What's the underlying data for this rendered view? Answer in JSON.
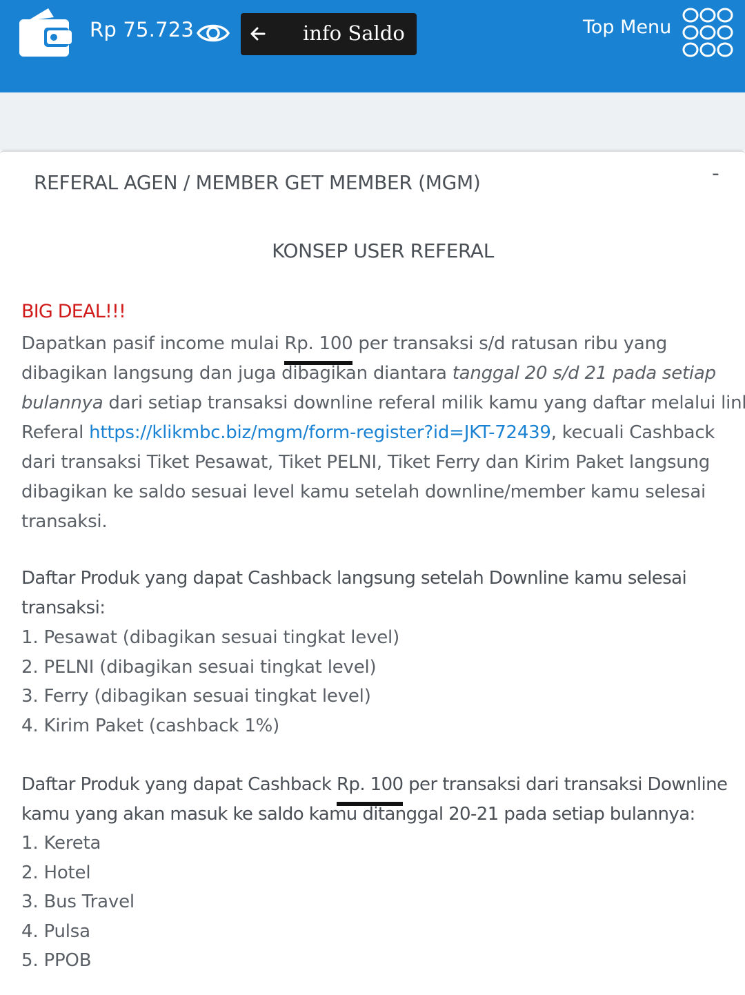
{
  "header": {
    "balance": "Rp 75.723",
    "info_saldo_label": "info Saldo",
    "top_menu_label": "Top Menu",
    "icons": {
      "wallet": "wallet-icon",
      "eye": "eye-icon",
      "back": "arrow-left-icon",
      "menu": "grid-menu-icon"
    },
    "colors": {
      "header_bg": "#1a82d3",
      "button_bg": "#1a1a1a"
    }
  },
  "card": {
    "title": "REFERAL AGEN / MEMBER GET MEMBER (MGM)",
    "collapse_label": "-",
    "section_title": "KONSEP USER REFERAL",
    "big_deal": "BIG DEAL!!!",
    "paragraph": {
      "l1_a": "Dapatkan pasif income mulai ",
      "l1_amount": "Rp. 100",
      "l1_b": " per transaksi s/d ratusan ribu yang",
      "l2_a": "dibagikan langsung dan juga dibagikan diantara ",
      "l2_italic": "tanggal 20 s/d 21 pada setiap",
      "l3_italic": "bulannya",
      "l3_b": " dari setiap transaksi downline referal milik kamu yang daftar melalui link",
      "l4_a": "Referal ",
      "l4_link": "https://klikmbc.biz/mgm/form-register?id=JKT-72439",
      "l4_b": ", kecuali Cashback",
      "l5": "dari transaksi Tiket Pesawat, Tiket PELNI, Tiket Ferry dan Kirim Paket langsung",
      "l6": "dibagikan ke saldo sesuai level kamu setelah downline/member kamu selesai",
      "l7": "transaksi."
    },
    "list1": {
      "heading_l1": "Daftar Produk yang dapat Cashback langsung setelah Downline kamu selesai",
      "heading_l2": "transaksi:",
      "items": [
        "1. Pesawat (dibagikan sesuai tingkat level)",
        "2. PELNI (dibagikan sesuai tingkat level)",
        "3. Ferry (dibagikan sesuai tingkat level)",
        "4. Kirim Paket (cashback 1%)"
      ]
    },
    "list2": {
      "heading_l1_a": "Daftar Produk yang dapat Cashback ",
      "heading_l1_amount": "Rp. 100",
      "heading_l1_b": " per transaksi dari transaksi Downline",
      "heading_l2": "kamu yang akan masuk ke saldo kamu ditanggal 20-21 pada setiap bulannya:",
      "items": [
        "1. Kereta",
        "2. Hotel",
        "3. Bus Travel",
        "4. Pulsa",
        "5. PPOB"
      ]
    },
    "colors": {
      "big_deal": "#d11a1a",
      "link": "#1a82d3"
    }
  }
}
